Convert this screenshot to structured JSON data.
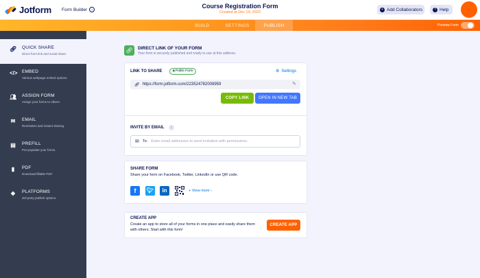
{
  "header": {
    "logo_text": "Jotform",
    "form_builder_label": "Form Builder",
    "form_title": "Course Registration Form",
    "form_created": "Created at Dec 19, 2023",
    "add_collaborators_label": "Add Collaborators",
    "help_label": "Help"
  },
  "nav": {
    "tabs": [
      {
        "label": "BUILD",
        "active": false
      },
      {
        "label": "SETTINGS",
        "active": false
      },
      {
        "label": "PUBLISH",
        "active": true
      }
    ],
    "preview_label": "Preview Form",
    "preview_on": false
  },
  "sidebar": {
    "items": [
      {
        "label": "QUICK SHARE",
        "desc": "Direct form link and social share.",
        "icon": "link-icon",
        "active": true
      },
      {
        "label": "EMBED",
        "desc": "Various webpage embed options.",
        "icon": "code-icon",
        "active": false
      },
      {
        "label": "ASSIGN FORM",
        "desc": "Assign your forms to others.",
        "icon": "users-icon",
        "active": false
      },
      {
        "label": "EMAIL",
        "desc": "Reminders and instant sharing.",
        "icon": "envelope-icon",
        "active": false
      },
      {
        "label": "PREFILL",
        "desc": "Pre-populate your forms.",
        "icon": "prefill-icon",
        "active": false
      },
      {
        "label": "PDF",
        "desc": "Download fillable PDF.",
        "icon": "pdf-icon",
        "active": false
      },
      {
        "label": "PLATFORMS",
        "desc": "3rd party publish options.",
        "icon": "layers-icon",
        "active": false
      }
    ]
  },
  "main": {
    "direct_link": {
      "title": "DIRECT LINK OF YOUR FORM",
      "subtitle": "Your form is securely published and ready to use at this address."
    },
    "link_card": {
      "label": "LINK TO SHARE",
      "badge": "Public Form",
      "settings_label": "Settings",
      "url": "https://form.jotform.com/223524782008959",
      "copy_label": "COPY LINK",
      "open_label": "OPEN IN NEW TAB",
      "invite_label": "INVITE BY EMAIL",
      "to_label": "To:",
      "email_placeholder": "Enter email addresses to send invitation with permissions."
    },
    "share_card": {
      "label": "SHARE FORM",
      "desc": "Share your form on Facebook, Twitter, LinkedIn or use QR code.",
      "view_more": "+ View more ›"
    },
    "app_card": {
      "label": "CREATE APP",
      "desc": "Create an app to store all of your forms in one place and easily share them with others. Start with this form!",
      "button_label": "CREATE APP"
    }
  },
  "colors": {
    "brand_orange": "#ff6100",
    "green": "#78bb07",
    "blue": "#4277ff",
    "sidebar": "#343c4f"
  }
}
